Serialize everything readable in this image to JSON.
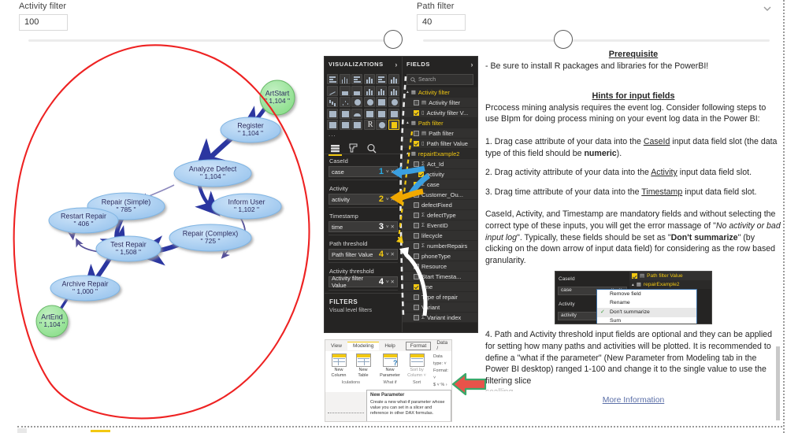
{
  "controls": {
    "activity_filter": {
      "label": "Activity filter",
      "value": "100"
    },
    "path_filter": {
      "label": "Path filter",
      "value": "40"
    },
    "collapse_icon": "chevron-down-icon"
  },
  "graph": {
    "title": "process-map",
    "nodes": [
      {
        "id": "ArtStart",
        "label": "ArtStart",
        "count": "\" 1,104 \"",
        "type": "start"
      },
      {
        "id": "Register",
        "label": "Register",
        "count": "\" 1,104 \"",
        "type": "activity"
      },
      {
        "id": "AnalyzeDefect",
        "label": "Analyze Defect",
        "count": "\" 1,104 \"",
        "type": "activity"
      },
      {
        "id": "InformUser",
        "label": "Inform User",
        "count": "\" 1,102 \"",
        "type": "activity"
      },
      {
        "id": "RepairSimple",
        "label": "Repair (Simple)",
        "count": "\" 785 \"",
        "type": "activity"
      },
      {
        "id": "RepairComplex",
        "label": "Repair (Complex)",
        "count": "\" 725 \"",
        "type": "activity"
      },
      {
        "id": "RestartRepair",
        "label": "Restart Repair",
        "count": "\" 406 \"",
        "type": "activity"
      },
      {
        "id": "TestRepair",
        "label": "Test Repair",
        "count": "\" 1,508 \"",
        "type": "activity"
      },
      {
        "id": "ArchiveRepair",
        "label": "Archive Repair",
        "count": "\" 1,000 \"",
        "type": "activity"
      },
      {
        "id": "ArtEnd",
        "label": "ArtEnd",
        "count": "\" 1,104 \"",
        "type": "end"
      }
    ]
  },
  "pbi_pane": {
    "visualizations": {
      "title": "VISUALIZATIONS",
      "chevron": "chevron-right-icon",
      "more": "..."
    },
    "fields_panel": {
      "title": "FIELDS",
      "chevron": "chevron-right-icon"
    },
    "search_placeholder": "Search",
    "tabs": [
      "fields-tab",
      "format-tab",
      "analytics-tab"
    ],
    "slots": [
      {
        "label": "CaseId",
        "value": "case",
        "num": "1",
        "num_color": "cyan"
      },
      {
        "label": "Activity",
        "value": "activity",
        "num": "2",
        "num_color": "amber"
      },
      {
        "label": "Timestamp",
        "value": "time",
        "num": "3",
        "num_color": "white"
      },
      {
        "label": "Path threshold",
        "value": "Path filter Value",
        "num": "4",
        "num_color": "amber"
      },
      {
        "label": "Activity threshold",
        "value": "Activity filter Value",
        "num": "4",
        "num_color": "white"
      }
    ],
    "filters_header": "FILTERS",
    "filters_sub": "Visual level filters",
    "field_tree": [
      {
        "text": "Activity filter",
        "level": 0,
        "checked": false,
        "kind": "table"
      },
      {
        "text": "Activity filter",
        "level": 1,
        "checked": false,
        "kind": "measure"
      },
      {
        "text": "Activity filter V...",
        "level": 1,
        "checked": true,
        "kind": "column"
      },
      {
        "text": "Path filter",
        "level": 0,
        "checked": false,
        "kind": "table"
      },
      {
        "text": "Path filter",
        "level": 1,
        "checked": false,
        "kind": "measure"
      },
      {
        "text": "Path filter Value",
        "level": 1,
        "checked": true,
        "kind": "column"
      },
      {
        "text": "repairExample2",
        "level": 0,
        "checked": false,
        "kind": "table"
      },
      {
        "text": "Act_Id",
        "level": 1,
        "checked": false,
        "kind": "sigma"
      },
      {
        "text": "activity",
        "level": 2,
        "checked": true,
        "kind": "plain"
      },
      {
        "text": "case",
        "level": 1,
        "checked": true,
        "kind": "sigma"
      },
      {
        "text": "Customer_Ou...",
        "level": 1,
        "checked": false,
        "kind": "plain"
      },
      {
        "text": "defectFixed",
        "level": 1,
        "checked": false,
        "kind": "plain"
      },
      {
        "text": "defectType",
        "level": 1,
        "checked": false,
        "kind": "sigma"
      },
      {
        "text": "EventID",
        "level": 1,
        "checked": false,
        "kind": "sigma"
      },
      {
        "text": "lifecycle",
        "level": 1,
        "checked": false,
        "kind": "plain"
      },
      {
        "text": "numberRepairs",
        "level": 1,
        "checked": false,
        "kind": "sigma"
      },
      {
        "text": "phoneType",
        "level": 1,
        "checked": false,
        "kind": "plain"
      },
      {
        "text": "Resource",
        "level": 1,
        "checked": false,
        "kind": "plain"
      },
      {
        "text": "Start Timesta...",
        "level": 1,
        "checked": false,
        "kind": "plain"
      },
      {
        "text": "time",
        "level": 1,
        "checked": true,
        "kind": "plain"
      },
      {
        "text": "Type of repair",
        "level": 1,
        "checked": false,
        "kind": "plain"
      },
      {
        "text": "Variant",
        "level": 1,
        "checked": false,
        "kind": "plain"
      },
      {
        "text": "Variant index",
        "level": 1,
        "checked": false,
        "kind": "sigma"
      }
    ]
  },
  "ribbon": {
    "tabs": [
      "View",
      "Modeling",
      "Help",
      "Format",
      "Data /"
    ],
    "active_tab": "Modeling",
    "buttons": [
      {
        "line1": "New",
        "line2": "Column",
        "group": "lculations"
      },
      {
        "line1": "New",
        "line2": "Table",
        "group": "lculations"
      },
      {
        "line1": "New",
        "line2": "Parameter",
        "group": "What if"
      },
      {
        "line1": "Sort by",
        "line2": "Column ˅",
        "group": "Sort"
      }
    ],
    "groups": [
      "lculations",
      "What if",
      "Sort",
      "Format"
    ],
    "format_lines": [
      "Data type: ˅",
      "Format: ˅",
      "$ ˅ % ›"
    ],
    "tooltip": {
      "title": "New Parameter",
      "body": "Create a new what-if parameter whose value you can set in a slicer and reference in other DAX formulas."
    },
    "red_arrow": "left-arrow-callout"
  },
  "text_panel": {
    "prerequisite_heading": "Prerequisite",
    "prerequisite_body": "- Be sure to install R packages and libraries for the PowerBI!",
    "hints_heading": "Hints for input fields",
    "intro": "Prcocess mining analysis requires the event log. Consider following steps to use BIpm for doing process mining on your event log data in the Power BI:",
    "step1_a": "1. Drag case attribute of your data into the ",
    "step1_link": "CaseId",
    "step1_b": " input data field slot (the data type of this field should be ",
    "step1_bold": "numeric",
    "step1_c": ").",
    "step2_a": "2. Drag activity attribute of your data into the ",
    "step2_link": "Activity",
    "step2_b": " input data field slot.",
    "step3_a": "3. Drag time attribute of your data into the ",
    "step3_link": "Timestamp",
    "step3_b": " input data field slot.",
    "mandatory_a": "CaseId, Activity, and Timestamp are mandatory fields and without selecting the correct type of these inputs, you will get the error massage of \"",
    "mandatory_italic": "No activity or bad input log",
    "mandatory_b": "\". Typically, these fields should be set as \"",
    "mandatory_bold": "Don't summarize",
    "mandatory_c": "\" (by clicking on the down arrow of input data field) for considering as the row based granularity.",
    "step4": "4. Path and Activity threshold input fields are optional and they can be applied for setting how many paths and activities will be plotted.  It is recommended to define a \"what if the parameter\" (New Parameter from Modeling tab in the Power BI desktop) ranged 1-100 and change it to the single value to use the filtering slice",
    "step4_cut": "scalling.",
    "more_information": "More Information"
  },
  "menu_shot": {
    "caseid_label": "CaseId",
    "caseid_value": "case",
    "activity_label": "Activity",
    "activity_value": "activity",
    "field_rows": [
      "Path filter Value",
      "repairExample2"
    ],
    "menu_items": [
      "Remove field",
      "Rename",
      "Don't summarize",
      "Sum"
    ],
    "checked_item": "Don't summarize"
  },
  "colors": {
    "accent_yellow": "#f2c811",
    "node_blue": "#a8cdf0",
    "node_green": "#97e397",
    "edge_blue": "#2b36a0",
    "annotation_red": "#ee2222",
    "link_blue": "#5b6fa8"
  }
}
